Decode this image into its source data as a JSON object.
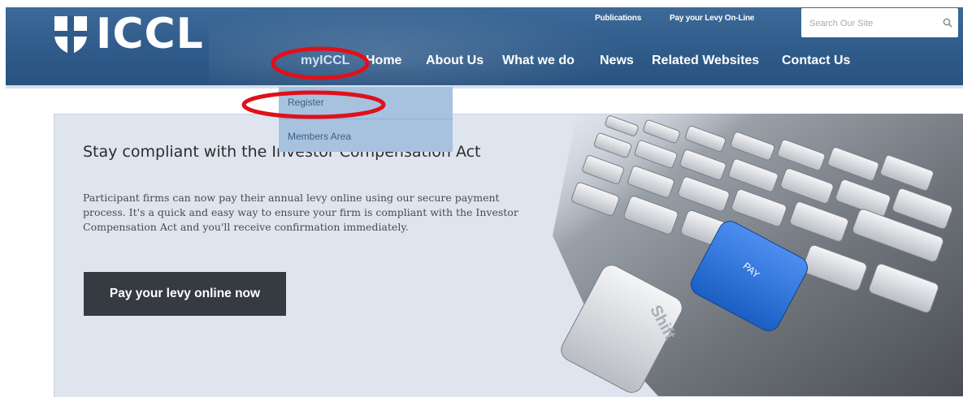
{
  "logo": {
    "text": "ICCL"
  },
  "utility_links": [
    "Publications",
    "Pay your Levy On-Line"
  ],
  "search": {
    "placeholder": "Search Our Site"
  },
  "nav": [
    "myICCL",
    "Home",
    "About Us",
    "What we do",
    "News",
    "Related Websites",
    "Contact Us"
  ],
  "dropdown": [
    "Register",
    "Members Area"
  ],
  "hero": {
    "title": "Stay compliant with the Investor Compensation Act",
    "body": "Participant firms can now pay their annual levy online using our secure payment process. It's a quick and easy way to ensure your firm is compliant with the Investor Compensation Act and you'll receive confirmation immediately.",
    "button": "Pay your levy online now"
  },
  "keyboard": {
    "pay_key": "PAY",
    "shift_key": "Shift"
  },
  "colors": {
    "header": "#2f5b8a",
    "dropdown": "#a7c2de",
    "hero_bg": "#dfe5ee",
    "cta": "#353b40",
    "pay_key": "#2f74d8",
    "annotation": "#e0101a"
  }
}
